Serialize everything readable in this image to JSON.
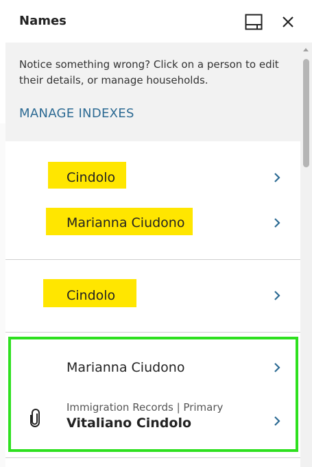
{
  "header": {
    "title": "Names"
  },
  "notice": {
    "text": "Notice something wrong? Click on a person to edit their details, or manage households.",
    "link": "MANAGE INDEXES"
  },
  "groups": [
    {
      "rows": [
        {
          "name": "Cindolo",
          "highlighted": true
        },
        {
          "name": "Marianna Ciudono",
          "highlighted": true
        }
      ]
    },
    {
      "rows": [
        {
          "name": "Cindolo",
          "highlighted": true
        }
      ]
    },
    {
      "selected": true,
      "rows": [
        {
          "name": "Marianna Ciudono",
          "highlighted": false
        },
        {
          "name": "Vitaliano Cindolo",
          "subtitle": "Immigration Records | Primary",
          "icon": "paperclip-icon",
          "bold": true
        }
      ]
    }
  ],
  "colors": {
    "highlight": "#ffe600",
    "selected_border": "#2ee01f",
    "link": "#2c6a93",
    "chevron": "#2c6a93"
  },
  "icons": {
    "toggle": "panel-dock-icon",
    "close": "close-icon",
    "chevron": "chevron-right-icon"
  }
}
